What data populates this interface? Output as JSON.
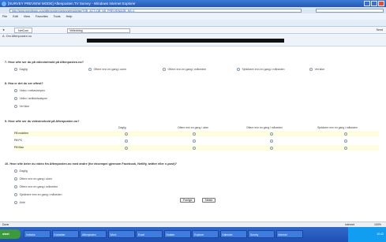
{
  "window": {
    "title": "[SURVEY PREVIEW MODE] Aftenposten.TV Survey - Windows Internet Explorer"
  },
  "address": {
    "url": "http://www.questback.com/aftenposten/aptvundersokelse/?QB_ACT=QB_NS_PREVIEW&QB_NS=1"
  },
  "menu": [
    "File",
    "Edit",
    "View",
    "Favorites",
    "Tools",
    "Help"
  ],
  "tabs": {
    "site": "NetCom",
    "tab_label": "Aftenposten.TV Survey",
    "search_field": "Veiledning",
    "right_tools": [
      "Send",
      "Gå",
      "Marker"
    ]
  },
  "page": {
    "subtitle": "A. Om Aftenposten.no"
  },
  "q7": {
    "text": "7. Hvor ofte ser du på videoinnhold på Aftenposten.no?",
    "options": [
      "Daglig",
      "Oftere enn en gang i uken",
      "Oftere enn en gang i måneden",
      "Sjeldnere enn en gang i måneden",
      "Vet ikke"
    ]
  },
  "q8": {
    "text": "8. Hva er det du ser oftest?",
    "options": [
      "Video i nettavisepen",
      "Video i artikkelsalspen",
      "Vet ikke"
    ]
  },
  "q9": {
    "text": "9. Hvor ofte ser du videoinnhold på Aftenposten.no?",
    "columns": [
      "Daglig",
      "Oftere enn en gang i uken",
      "Oftere enn en gang i måneden",
      "Sjeldnere enn en gang i måneden"
    ],
    "rows": [
      "På mobilen",
      "På PC",
      "På Mac"
    ]
  },
  "q10": {
    "text": "10. Hvor ofte deler du video fra Aftenposten.no med andre (for eksempel gjennom Facebook, Netlify, twitter eller e-post)?",
    "options": [
      "Daglig",
      "Oftere enn en gang i uken",
      "Oftere enn en gang i måneden",
      "Sjeldnere enn en gang i måneden",
      "Aldri"
    ]
  },
  "buttons": {
    "prev": "Forrige",
    "next": "Neste"
  },
  "status": {
    "left": "Done",
    "zone": "Internet",
    "zoom": "100%"
  },
  "taskbar": {
    "start": "start",
    "items": [
      "Innboks",
      "Kontakter",
      "Aftenposten",
      "Word",
      "Excel",
      "Notater",
      "Explorer",
      "Kalender",
      "Survey",
      "Internet",
      "Dokument"
    ],
    "clock": "10:42"
  }
}
